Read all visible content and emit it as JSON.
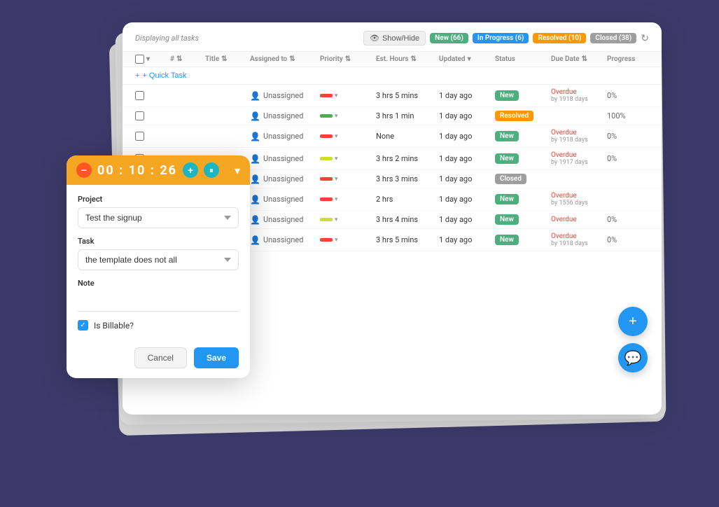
{
  "page": {
    "background_color": "#3d3a6b"
  },
  "top_bar": {
    "displaying_text": "Displaying all tasks",
    "show_hide_label": "Show/Hide",
    "badges": {
      "new_label": "New (66)",
      "inprogress_label": "In Progress (6)",
      "resolved_label": "Resolved (10)",
      "closed_label": "Closed (38)"
    }
  },
  "table": {
    "columns": [
      "",
      "#",
      "Title",
      "Assigned to",
      "Priority",
      "Est. Hours",
      "Updated",
      "Status",
      "Due Date",
      "Progress"
    ],
    "quick_task_label": "+ Quick Task",
    "rows": [
      {
        "assigned": "Unassigned",
        "priority": "high",
        "est_hours": "3 hrs 5 mins",
        "updated": "1 day ago",
        "status": "New",
        "status_type": "new",
        "due_date": "Overdue",
        "due_sub": "by 1918 days",
        "progress": "0%"
      },
      {
        "assigned": "Unassigned",
        "priority": "medium",
        "est_hours": "3 hrs 1 min",
        "updated": "1 day ago",
        "status": "Resolved",
        "status_type": "resolved",
        "due_date": "",
        "due_sub": "",
        "progress": "100%"
      },
      {
        "assigned": "Unassigned",
        "priority": "high",
        "est_hours": "None",
        "updated": "1 day ago",
        "status": "New",
        "status_type": "new",
        "due_date": "Overdue",
        "due_sub": "by 1918 days",
        "progress": "0%"
      },
      {
        "assigned": "Unassigned",
        "priority": "low",
        "est_hours": "3 hrs 2 mins",
        "updated": "1 day ago",
        "status": "New",
        "status_type": "new",
        "due_date": "Overdue",
        "due_sub": "by 1917 days",
        "progress": "0%"
      },
      {
        "assigned": "Unassigned",
        "priority": "high",
        "est_hours": "3 hrs 3 mins",
        "updated": "1 day ago",
        "status": "Closed",
        "status_type": "closed",
        "due_date": "",
        "due_sub": "",
        "progress": ""
      },
      {
        "assigned": "Unassigned",
        "priority": "high",
        "est_hours": "2 hrs",
        "updated": "1 day ago",
        "status": "New",
        "status_type": "new",
        "due_date": "Overdue",
        "due_sub": "by 1556 days",
        "progress": ""
      },
      {
        "assigned": "Unassigned",
        "priority": "low",
        "est_hours": "3 hrs 4 mins",
        "updated": "1 day ago",
        "status": "New",
        "status_type": "new",
        "due_date": "Overdue",
        "due_sub": "",
        "progress": "0%"
      },
      {
        "assigned": "Unassigned",
        "priority": "high",
        "est_hours": "3 hrs 5 mins",
        "updated": "1 day ago",
        "status": "New",
        "status_type": "new",
        "due_date": "Overdue",
        "due_sub": "by 1918 days",
        "progress": "0%"
      }
    ]
  },
  "timer": {
    "minus_label": "−",
    "time_display": "00 : 10 : 26",
    "add_label": "+",
    "pause_label": "⏸",
    "chevron_label": "▾",
    "project_label": "Project",
    "project_value": "Test the signup",
    "task_label": "Task",
    "task_value": "the template does not all",
    "note_label": "Note",
    "note_placeholder": "",
    "billable_label": "Is Billable?",
    "cancel_label": "Cancel",
    "save_label": "Save"
  }
}
